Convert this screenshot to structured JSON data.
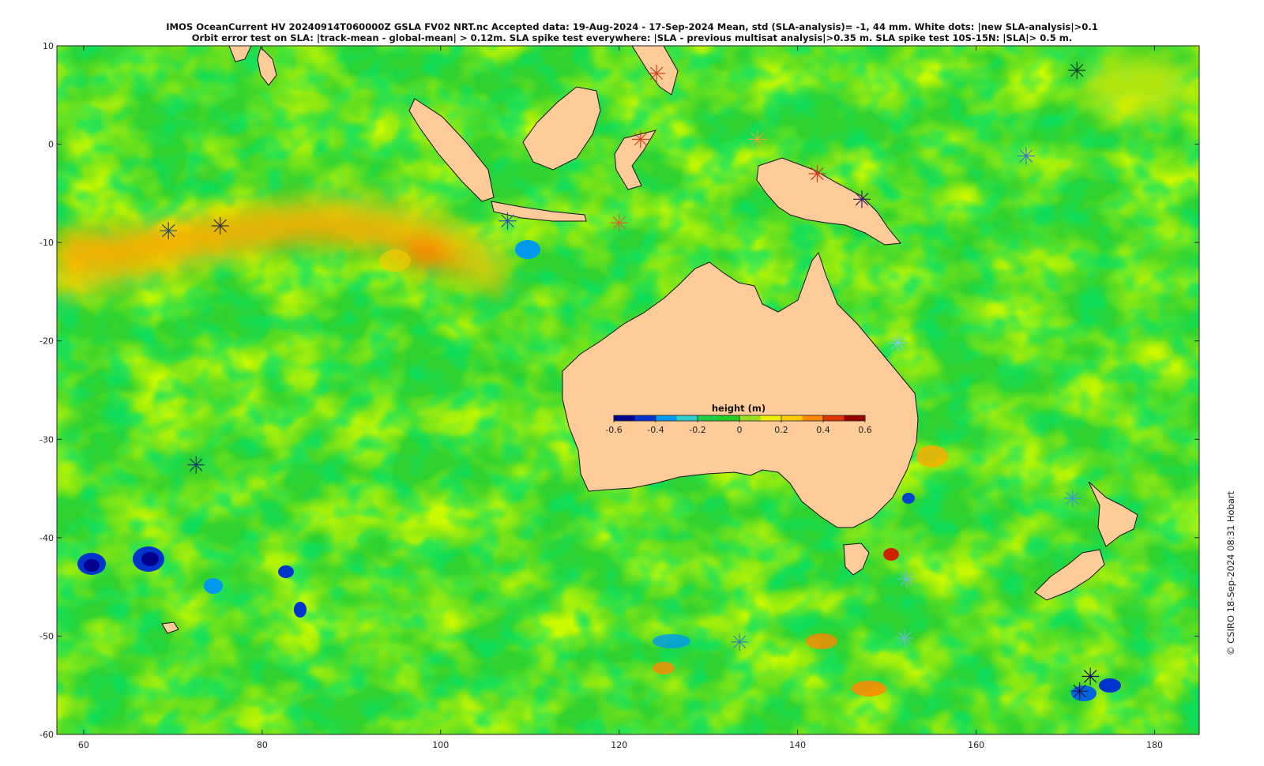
{
  "title": {
    "line1": "IMOS OceanCurrent HV 20240914T060000Z GSLA FV02 NRT.nc  Accepted data: 19-Aug-2024 - 17-Sep-2024 Mean, std (SLA-analysis)= -1, 44 mm. White dots: |new SLA-analysis|>0.1",
    "line2": "Orbit error test on SLA: |track-mean  - global-mean| > 0.12m.  SLA spike test everywhere: |SLA - previous multisat analysis|>0.35 m. SLA spike test 10S-15N: |SLA|> 0.5 m."
  },
  "credit": "© CSIRO 18-Sep-2024 08:31 Hobart",
  "map": {
    "lon_range": [
      57,
      185
    ],
    "lat_range": [
      -60,
      10
    ],
    "x_ticks": [
      "60",
      "80",
      "100",
      "120",
      "140",
      "160",
      "180"
    ],
    "y_ticks": [
      "10",
      "0",
      "-10",
      "-20",
      "-30",
      "-40",
      "-50",
      "-60"
    ],
    "land_color": "#ffcc99",
    "ocean_base_color": "#2fd12f"
  },
  "colorbar": {
    "label": "height (m)",
    "ticks": [
      "-0.6",
      "-0.4",
      "-0.2",
      "0",
      "0.2",
      "0.4",
      "0.6"
    ],
    "range": [
      -0.6,
      0.6
    ],
    "colors": [
      "#00008f",
      "#0033cc",
      "#0099ee",
      "#33cccc",
      "#22cc44",
      "#22cc22",
      "#99dd22",
      "#eeee00",
      "#ffcc00",
      "#ff8800",
      "#dd3300",
      "#990000"
    ]
  },
  "markers": [
    {
      "lon": 69.5,
      "lat": -8.8,
      "color": "#2a4a6a"
    },
    {
      "lon": 75.3,
      "lat": -8.3,
      "color": "#333333"
    },
    {
      "lon": 72.6,
      "lat": -32.6,
      "color": "#1a3a66"
    },
    {
      "lon": 107.5,
      "lat": -7.8,
      "color": "#2255aa"
    },
    {
      "lon": 124.2,
      "lat": 7.2,
      "color": "#cc4422"
    },
    {
      "lon": 122.4,
      "lat": 0.5,
      "color": "#cc4422"
    },
    {
      "lon": 120.0,
      "lat": -8.0,
      "color": "#cc6633"
    },
    {
      "lon": 135.5,
      "lat": 0.5,
      "color": "#ddaa33"
    },
    {
      "lon": 142.2,
      "lat": -3.0,
      "color": "#cc3322"
    },
    {
      "lon": 147.2,
      "lat": -5.6,
      "color": "#332266"
    },
    {
      "lon": 171.3,
      "lat": 7.5,
      "color": "#1a3a2a"
    },
    {
      "lon": 165.6,
      "lat": -1.2,
      "color": "#3377cc"
    },
    {
      "lon": 151.2,
      "lat": -20.2,
      "color": "#88ccdd"
    },
    {
      "lon": 170.8,
      "lat": -36.0,
      "color": "#3399dd"
    },
    {
      "lon": 152.2,
      "lat": -44.2,
      "color": "#66bbdd"
    },
    {
      "lon": 152.0,
      "lat": -50.2,
      "color": "#66bbdd"
    },
    {
      "lon": 133.5,
      "lat": -50.6,
      "color": "#3388aa"
    },
    {
      "lon": 172.8,
      "lat": -54.1,
      "color": "#111155"
    },
    {
      "lon": 171.6,
      "lat": -55.6,
      "color": "#111155"
    }
  ]
}
